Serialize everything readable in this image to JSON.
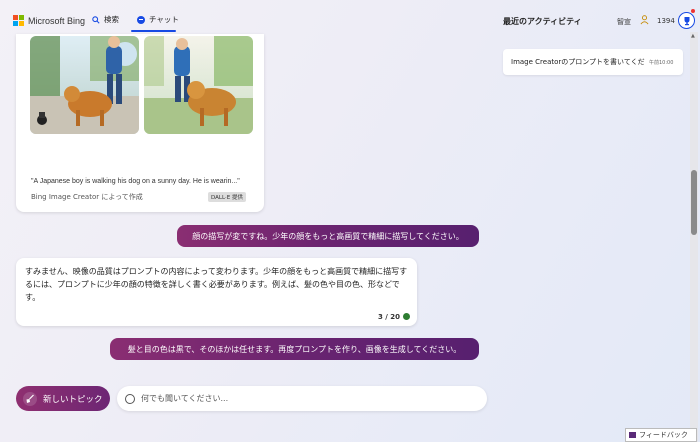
{
  "header": {
    "logo_text": "Microsoft Bing",
    "tab_search": "検索",
    "tab_chat": "チャット",
    "activity_title": "最近のアクティビティ",
    "reward_label": "智宣",
    "points": "1394"
  },
  "image_card": {
    "prompt": "\"A Japanese boy is walking his dog on a sunny day. He is wearin...\"",
    "creator": "Bing Image Creator によって作成",
    "badge": "DALL·E 提供"
  },
  "messages": {
    "user1": "顔の描写が変ですね。少年の顔をもっと高画質で精細に描写してください。",
    "bot1": "すみません、映像の品質はプロンプトの内容によって変わります。少年の顔をもっと高画質で精細に描写するには、プロンプトに少年の顔の特徴を詳しく書く必要があります。例えば、髪の色や目の色、形などです。",
    "bot1_count": "3 / 20",
    "user2": "髪と目の色は黒で、そのほかは任せます。再度プロンプトを作り、画像を生成してください。"
  },
  "bottom": {
    "new_topic": "新しいトピック",
    "placeholder": "何でも聞いてください..."
  },
  "activity": {
    "item_text": "Image Creatorのプロンプトを書いてくだ",
    "item_time": "午前10:00"
  },
  "feedback": "フィードバック",
  "colors": {
    "accent_blue": "#174ae4",
    "user_bubble": "#6a2470",
    "status_green": "#2e7d32"
  }
}
